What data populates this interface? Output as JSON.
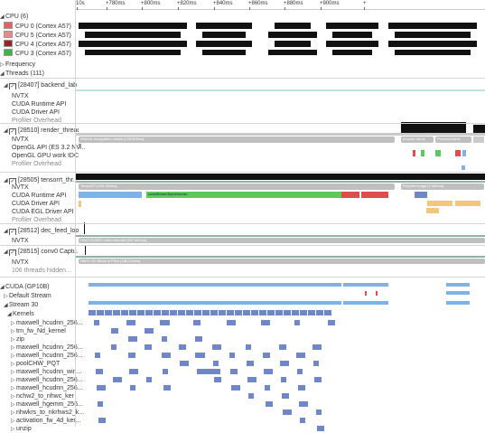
{
  "ruler": {
    "ticks": [
      "10s",
      "+780ms",
      "+800ms",
      "+820ms",
      "+840ms",
      "+860ms",
      "+880ms",
      "+900ms",
      "+"
    ]
  },
  "cpu": {
    "header": "CPU (6)",
    "cores": [
      {
        "label": "CPU 0 (Cortex A57)",
        "color": "#f25b5b"
      },
      {
        "label": "CPU 5 (Cortex A57)",
        "color": "#e58a8a"
      },
      {
        "label": "CPU 4 (Cortex A57)",
        "color": "#9b2323"
      },
      {
        "label": "CPU 3 (Cortex A57)",
        "color": "#3cb44b"
      }
    ]
  },
  "frequency_label": "Frequency",
  "threads": {
    "header": "Threads (111)",
    "t1": {
      "title": "[28407] backend_lab",
      "rows": [
        "NVTX",
        "CUDA Runtime API",
        "CUDA Driver API",
        "Profiler Overhead"
      ]
    },
    "t2": {
      "title": "[28510] render_thread",
      "rows": [
        "NVTX",
        "OpenGL API (ES 3.2 NV...",
        "OpenGL GPU work IDC",
        "Profiler Overhead"
      ],
      "bars": {
        "wait": "Wait for recognition results [125.808ms]",
        "acquire": "Acquire frame",
        "present": "Process frame"
      }
    },
    "t3": {
      "title": "[28505] tensorrt_thr...",
      "rows": [
        "NVTX",
        "CUDA Runtime API",
        "CUDA Driver API",
        "CUDA EGL Driver API",
        "Profiler Overhead"
      ],
      "bars": {
        "tensorrt": "TensorRT [155.160ms]",
        "sync": "cudaStreamSynchronize",
        "prepare": "Prepare image [9.480ms]"
      }
    },
    "t4": {
      "title": "[28512] dec_feed_loop",
      "rows": [
        "NVTX"
      ],
      "bars": {
        "nvdec": "HW/2 NVDEC video decode [187.462ms]"
      }
    },
    "t5": {
      "title": "[28515] conv0 Captu...",
      "rows": [
        "NVTX"
      ],
      "bars": {
        "vic": "HW/2 VIC Block to Pitch [186.234ms]"
      }
    },
    "hidden": "106 threads hidden..."
  },
  "cuda": {
    "header": "CUDA (GP10B)",
    "default_stream": "Default Stream",
    "stream": "Stream 30",
    "kernels_label": "Kernels",
    "kernels": [
      "maxwell_hcudnn_256...",
      "trn_fw_Nd_kernel",
      "zip",
      "maxwell_hcudnn_256...",
      "maxwell_hcudnn_256...",
      "poolCHW_PQT",
      "maxwell_hcudnn_win...",
      "maxwell_hcudnn_256...",
      "maxwell_hcudnn_256...",
      "nchw2_to_nhwc_ker",
      "maxwell_hgemm_256...",
      "nhwkrs_to_nkrhws2_k...",
      "activation_fw_4d_ker...",
      "unzip"
    ]
  },
  "colors": {
    "kernel": "#6f86c9",
    "memcpy": "#7fb2e5",
    "sync_green": "#5cc95c",
    "alert_red": "#e04c4c",
    "cpu_busy": "#111111"
  }
}
